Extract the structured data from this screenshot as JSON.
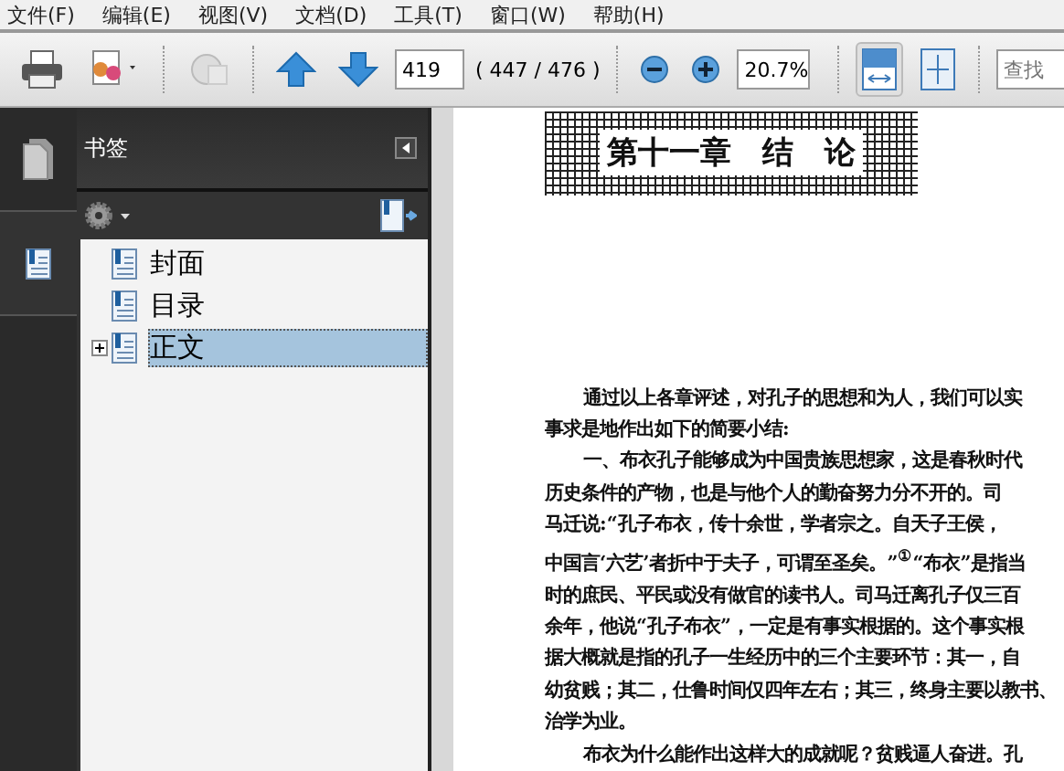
{
  "menu": [
    {
      "label": "文件(F)"
    },
    {
      "label": "编辑(E)"
    },
    {
      "label": "视图(V)"
    },
    {
      "label": "文档(D)"
    },
    {
      "label": "工具(T)"
    },
    {
      "label": "窗口(W)"
    },
    {
      "label": "帮助(H)"
    }
  ],
  "toolbar": {
    "page_number": "419",
    "page_count": "( 447 / 476 )",
    "zoom": "20.7%",
    "search": {
      "placeholder": "查找"
    },
    "fit_width_selected": true
  },
  "panel": {
    "title": "书签",
    "bookmarks": [
      {
        "label": "封面",
        "selected": false,
        "has_children": false
      },
      {
        "label": "目录",
        "selected": false,
        "has_children": false
      },
      {
        "label": "正文",
        "selected": true,
        "expanded": false,
        "has_children": true
      }
    ]
  },
  "document": {
    "heading": "第十一章　结　论",
    "lines": [
      {
        "text": "通过以上各章评述，对孔子的思想和为人，我们可以实",
        "indent": true
      },
      {
        "text": "事求是地作出如下的简要小结:",
        "indent": false
      },
      {
        "text": "一、布衣孔子能够成为中国贵族思想家，这是春秋时代",
        "indent": true
      },
      {
        "text": "历史条件的产物，也是与他个人的勤奋努力分不开的。司",
        "indent": false
      },
      {
        "text": "马迁说:“孔子布衣，传十余世，学者宗之。自天子王侯，",
        "indent": false
      },
      {
        "text": "中国言‘六艺’者折中于夫子，可谓至圣矣。”$^{①}$“布衣”是指当",
        "indent": false
      },
      {
        "text": "时的庶民、平民或没有做官的读书人。司马迁离孔子仅三百",
        "indent": false
      },
      {
        "text": "余年，他说“孔子布衣”，一定是有事实根据的。这个事实根",
        "indent": false
      },
      {
        "text": "据大概就是指的孔子一生经历中的三个主要环节：其一，自",
        "indent": false
      },
      {
        "text": "幼贫贱；其二，仕鲁时间仅四年左右；其三，终身主要以教书、",
        "indent": false
      },
      {
        "text": "治学为业。",
        "indent": false
      },
      {
        "text": "布衣为什么能作出这样大的成就呢？贫贱逼人奋进。孔",
        "indent": true
      }
    ]
  }
}
